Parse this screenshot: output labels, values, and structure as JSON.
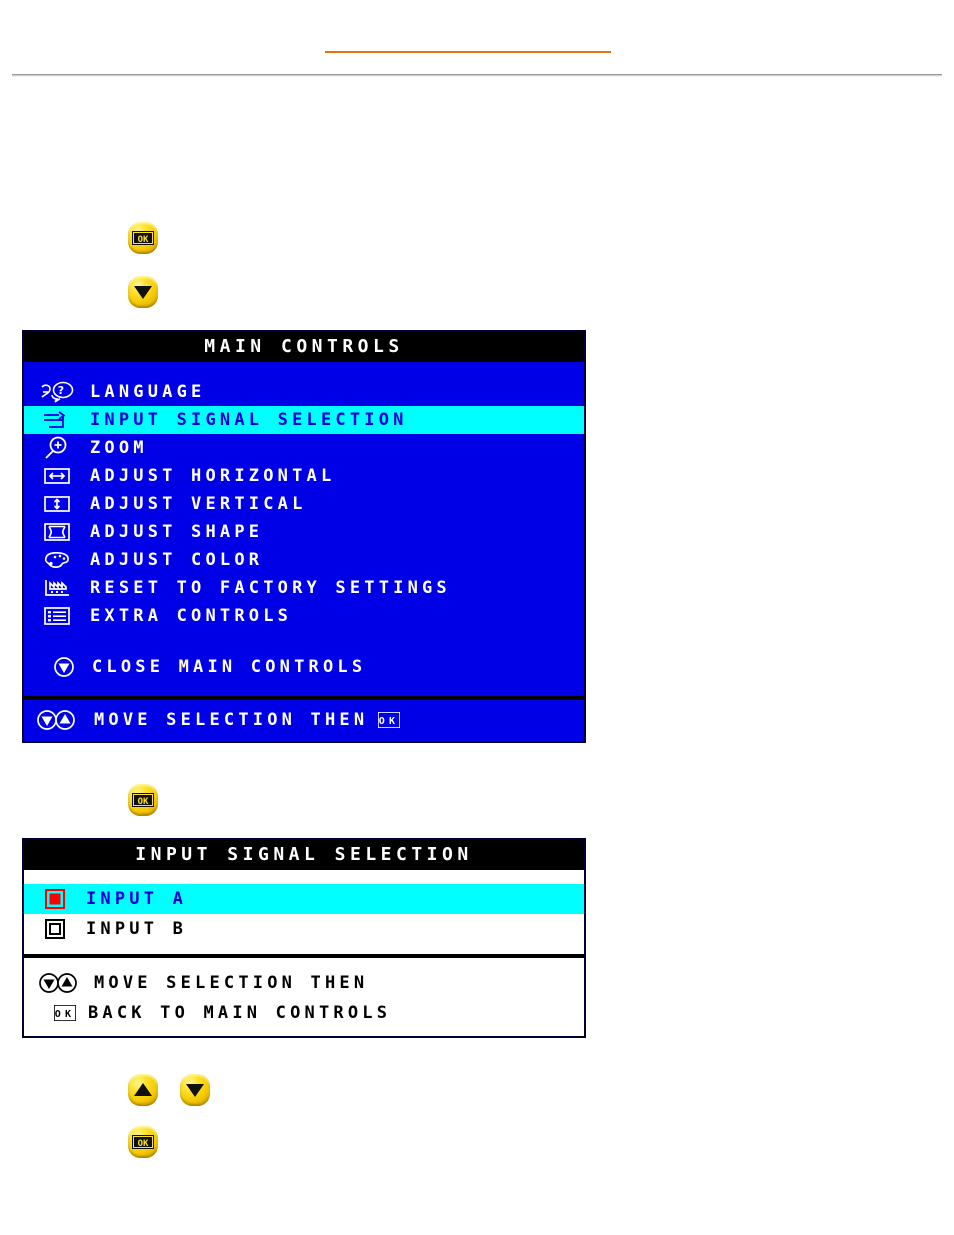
{
  "page": {
    "top_link_rule_color": "#e8730c",
    "horizontal_rule_color": "#9a9a9a"
  },
  "steps": {
    "button_ok_1": "OK",
    "button_down_1": "DOWN",
    "button_ok_2": "OK",
    "button_up_3": "UP",
    "button_down_3": "DOWN",
    "button_ok_3": "OK"
  },
  "main_controls": {
    "title": "MAIN CONTROLS",
    "colors": {
      "background": "#0000e6",
      "title_bar": "#000000",
      "highlight": "#00ffff",
      "highlight_text": "#0000dd",
      "text": "#ffffff"
    },
    "items": [
      {
        "label": "LANGUAGE",
        "icon": "language-icon",
        "selected": false
      },
      {
        "label": "INPUT SIGNAL SELECTION",
        "icon": "input-signal-icon",
        "selected": true
      },
      {
        "label": "ZOOM",
        "icon": "zoom-icon",
        "selected": false
      },
      {
        "label": "ADJUST HORIZONTAL",
        "icon": "adjust-horizontal-icon",
        "selected": false
      },
      {
        "label": "ADJUST VERTICAL",
        "icon": "adjust-vertical-icon",
        "selected": false
      },
      {
        "label": "ADJUST SHAPE",
        "icon": "adjust-shape-icon",
        "selected": false
      },
      {
        "label": "ADJUST COLOR",
        "icon": "adjust-color-icon",
        "selected": false
      },
      {
        "label": "RESET TO FACTORY SETTINGS",
        "icon": "reset-factory-icon",
        "selected": false
      },
      {
        "label": "EXTRA CONTROLS",
        "icon": "extra-controls-icon",
        "selected": false
      }
    ],
    "close_label": "CLOSE MAIN CONTROLS",
    "close_icon": "down-arrow-circle-icon",
    "footer_text": "MOVE SELECTION THEN",
    "footer_ok_glyph": "OK"
  },
  "input_signal": {
    "title": "INPUT SIGNAL SELECTION",
    "colors": {
      "background": "#ffffff",
      "title_bar": "#000000",
      "highlight": "#00ffff",
      "highlight_text": "#0000dd",
      "text": "#000000",
      "selected_radio": "#ff0000"
    },
    "options": [
      {
        "label": "INPUT A",
        "selected": true
      },
      {
        "label": "INPUT B",
        "selected": false
      }
    ],
    "footer_line_1": "MOVE SELECTION THEN",
    "footer_line_2": "BACK TO MAIN CONTROLS",
    "footer_ok_glyph": "OK"
  }
}
